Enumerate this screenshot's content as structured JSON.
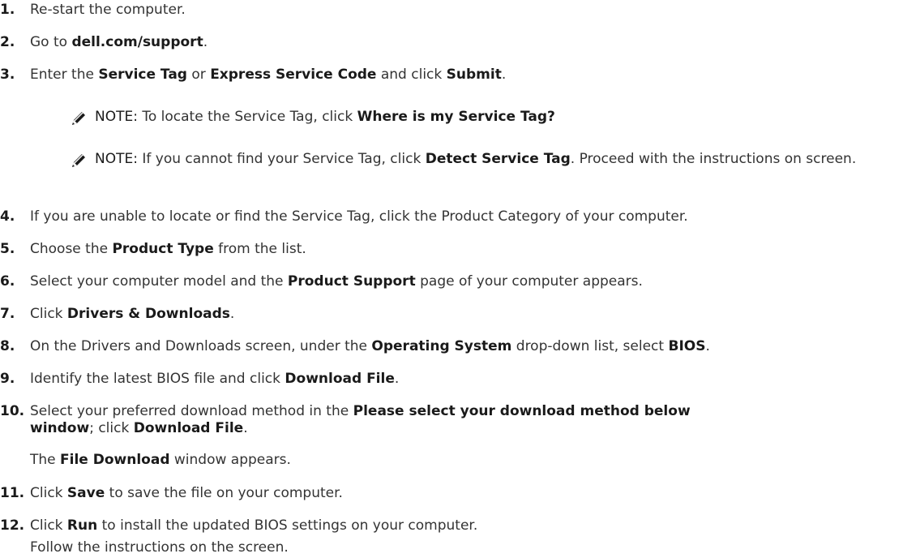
{
  "steps": [
    {
      "num": "1.",
      "parts": [
        [
          "t",
          "Re-start the computer."
        ]
      ]
    },
    {
      "num": "2.",
      "parts": [
        [
          "t",
          "Go to "
        ],
        [
          "b",
          "dell.com/support"
        ],
        [
          "t",
          "."
        ]
      ]
    },
    {
      "num": "3.",
      "parts": [
        [
          "t",
          "Enter the "
        ],
        [
          "b",
          "Service Tag"
        ],
        [
          "t",
          " or "
        ],
        [
          "b",
          "Express Service Code"
        ],
        [
          "t",
          " and click "
        ],
        [
          "b",
          "Submit"
        ],
        [
          "t",
          "."
        ]
      ]
    }
  ],
  "notes": [
    {
      "label": "NOTE:",
      "parts": [
        [
          "t",
          " To locate the Service Tag, click "
        ],
        [
          "b",
          "Where is my Service Tag?"
        ]
      ]
    },
    {
      "label": "NOTE:",
      "parts": [
        [
          "t",
          " If you cannot find your Service Tag, click "
        ],
        [
          "b",
          "Detect Service Tag"
        ],
        [
          "t",
          ". Proceed with the instructions on screen."
        ]
      ]
    }
  ],
  "steps2": [
    {
      "num": "4.",
      "parts": [
        [
          "t",
          "If you are unable to locate or find the Service Tag, click the Product Category of your computer."
        ]
      ]
    },
    {
      "num": "5.",
      "parts": [
        [
          "t",
          "Choose the "
        ],
        [
          "b",
          "Product Type"
        ],
        [
          "t",
          " from the list."
        ]
      ]
    },
    {
      "num": "6.",
      "parts": [
        [
          "t",
          "Select your computer model and the "
        ],
        [
          "b",
          "Product Support"
        ],
        [
          "t",
          " page of your computer appears."
        ]
      ]
    },
    {
      "num": "7.",
      "parts": [
        [
          "t",
          "Click "
        ],
        [
          "b",
          "Drivers & Downloads"
        ],
        [
          "t",
          "."
        ]
      ]
    },
    {
      "num": "8.",
      "parts": [
        [
          "t",
          "On the Drivers and Downloads screen, under the "
        ],
        [
          "b",
          "Operating System"
        ],
        [
          "t",
          " drop-down list, select "
        ],
        [
          "b",
          "BIOS"
        ],
        [
          "t",
          "."
        ]
      ]
    },
    {
      "num": "9.",
      "parts": [
        [
          "t",
          "Identify the latest BIOS file and click "
        ],
        [
          "b",
          "Download File"
        ],
        [
          "t",
          "."
        ]
      ]
    },
    {
      "num": "10.",
      "parts": [
        [
          "t",
          "Select your preferred download method in the "
        ],
        [
          "b",
          "Please select your download method below window"
        ],
        [
          "t",
          "; click "
        ],
        [
          "b",
          "Download File"
        ],
        [
          "t",
          "."
        ]
      ]
    }
  ],
  "step10_result": [
    [
      "t",
      "The "
    ],
    [
      "b",
      "File Download"
    ],
    [
      "t",
      " window appears."
    ]
  ],
  "steps3": [
    {
      "num": "11.",
      "parts": [
        [
          "t",
          "Click "
        ],
        [
          "b",
          "Save"
        ],
        [
          "t",
          " to save the file on your computer."
        ]
      ]
    },
    {
      "num": "12.",
      "parts": [
        [
          "t",
          "Click "
        ],
        [
          "b",
          "Run"
        ],
        [
          "t",
          " to install the updated BIOS settings on your computer."
        ]
      ]
    }
  ],
  "step12_result": "Follow the instructions on the screen.",
  "colors": {
    "text": "#333333",
    "icon": "#1a1a1a"
  },
  "icons": {
    "note": "pencil-icon"
  }
}
